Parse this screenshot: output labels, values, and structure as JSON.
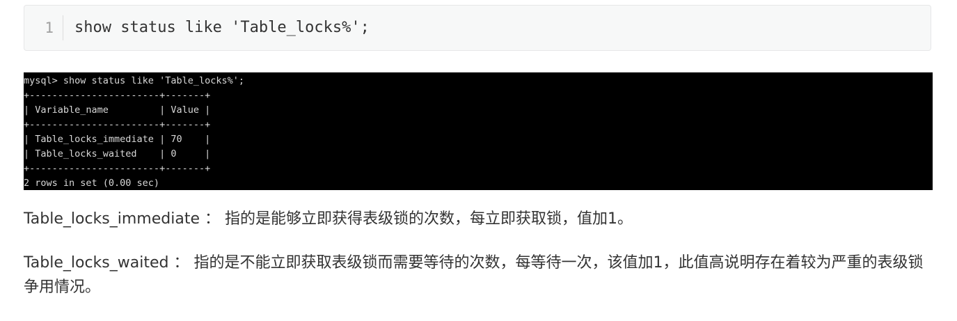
{
  "code_block": {
    "line_number": "1",
    "code": "show status like 'Table_locks%';"
  },
  "terminal": {
    "lines": [
      "mysql> show status like 'Table_locks%';",
      "+-----------------------+-------+",
      "| Variable_name         | Value |",
      "+-----------------------+-------+",
      "| Table_locks_immediate | 70    |",
      "| Table_locks_waited    | 0     |",
      "+-----------------------+-------+",
      "2 rows in set (0.00 sec)"
    ]
  },
  "paragraphs": [
    {
      "term": "Table_locks_immediate ：",
      "text": "指的是能够立即获得表级锁的次数，每立即获取锁，值加1。"
    },
    {
      "term": "Table_locks_waited ：",
      "text": "指的是不能立即获取表级锁而需要等待的次数，每等待一次，该值加1，此值高说明存在着较为严重的表级锁争用情况。"
    }
  ]
}
